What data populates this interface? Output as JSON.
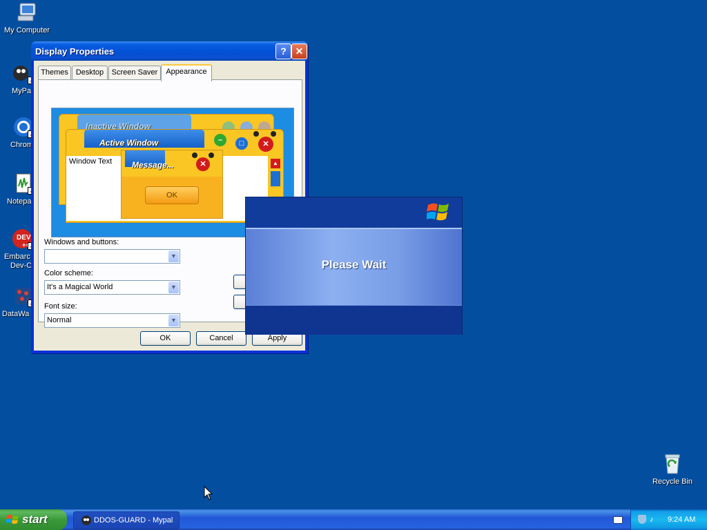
{
  "desktop": {
    "icons": [
      {
        "label": "My Computer",
        "icon": "my-computer-icon"
      },
      {
        "label": "MyPa",
        "icon": "mypal-icon"
      },
      {
        "label": "Chrom",
        "icon": "chrome-icon"
      },
      {
        "label": "Notepa",
        "icon": "notepad-icon"
      },
      {
        "label": "Embarc",
        "label2": "Dev-C",
        "icon": "devcpp-icon"
      },
      {
        "label": "DataWa",
        "icon": "datawave-icon"
      },
      {
        "label": "Recycle Bin",
        "icon": "recycle-bin-icon"
      }
    ]
  },
  "display_properties": {
    "title": "Display Properties",
    "help_glyph": "?",
    "close_glyph": "✕",
    "tabs": [
      "Themes",
      "Desktop",
      "Screen Saver",
      "Appearance"
    ],
    "active_tab": "Appearance",
    "preview": {
      "inactive_title": "Inactive Window",
      "active_title": "Active Window",
      "window_text": "Window Text",
      "message_title": "Message...",
      "ok_label": "OK"
    },
    "windows_buttons_label": "Windows and buttons:",
    "windows_buttons_value": "",
    "color_scheme_label": "Color scheme:",
    "color_scheme_value": "It's a Magical World",
    "font_size_label": "Font size:",
    "font_size_value": "Normal",
    "buttons": {
      "ok": "OK",
      "cancel": "Cancel",
      "apply": "Apply"
    }
  },
  "please_wait": {
    "text": "Please Wait"
  },
  "taskbar": {
    "start_label": "start",
    "tasks": [
      {
        "label": "DDOS-GUARD - Mypal",
        "icon": "mypal-icon"
      }
    ],
    "clock": "9:24 AM"
  },
  "colors": {
    "desktop": "#044ea0",
    "titlebar": "#0a5ee0",
    "start_green": "#3a9a3a",
    "tray": "#139ee9",
    "preview_yellow": "#f9c623"
  }
}
